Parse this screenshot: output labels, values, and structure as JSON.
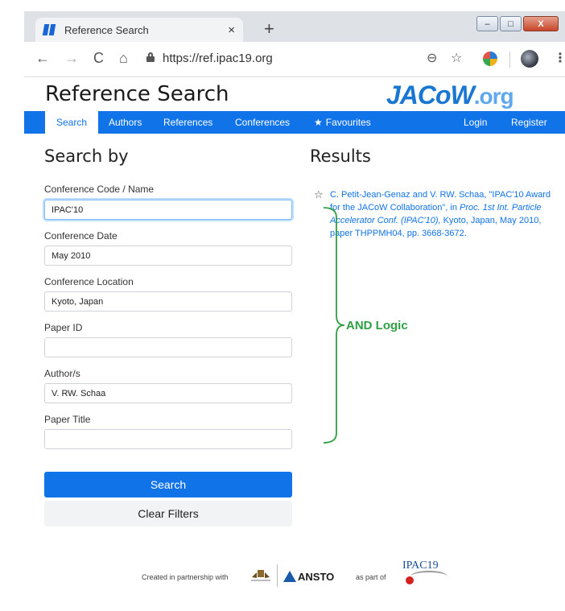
{
  "browser": {
    "tab_title": "Reference Search",
    "tab_close": "×",
    "new_tab": "+",
    "url": "https://ref.ipac19.org",
    "back": "←",
    "forward": "→",
    "reload": "C",
    "home": "⌂",
    "zoom": "⊖",
    "bookmark": "☆",
    "menu": "⋮",
    "win_min": "–",
    "win_max": "□",
    "win_close": "X"
  },
  "header": {
    "title": "Reference Search",
    "brand_main": "JACoW",
    "brand_suffix": ".org"
  },
  "nav": {
    "items": [
      {
        "label": "Search"
      },
      {
        "label": "Authors"
      },
      {
        "label": "References"
      },
      {
        "label": "Conferences"
      },
      {
        "label": "Favourites"
      }
    ],
    "login": "Login",
    "register": "Register"
  },
  "search_panel": {
    "heading": "Search by",
    "fields": [
      {
        "label": "Conference Code / Name",
        "value": "IPAC'10"
      },
      {
        "label": "Conference Date",
        "value": "May 2010"
      },
      {
        "label": "Conference Location",
        "value": "Kyoto, Japan"
      },
      {
        "label": "Paper ID",
        "value": ""
      },
      {
        "label": "Author/s",
        "value": "V. RW. Schaa"
      },
      {
        "label": "Paper Title",
        "value": ""
      }
    ],
    "search_button": "Search",
    "clear_button": "Clear Filters"
  },
  "results": {
    "heading": "Results",
    "items": [
      {
        "prefix": "C. Petit-Jean-Genaz and V. RW. Schaa, \"IPAC'10 Award for the JACoW Collaboration\", in ",
        "proceedings": "Proc. 1st Int. Particle Accelerator Conf. (IPAC'10),",
        "suffix": " Kyoto, Japan, May 2010, paper THPPMH04, pp. 3668-3672."
      }
    ]
  },
  "annotation": {
    "label": "AND Logic",
    "color": "#2f9e44"
  },
  "footer": {
    "credit": "Created in partnership with",
    "partner": "ANSTO",
    "as_part_of": "as part of",
    "event": "IPAC19"
  },
  "colors": {
    "accent": "#1073e8",
    "brand": "#1976d2"
  }
}
